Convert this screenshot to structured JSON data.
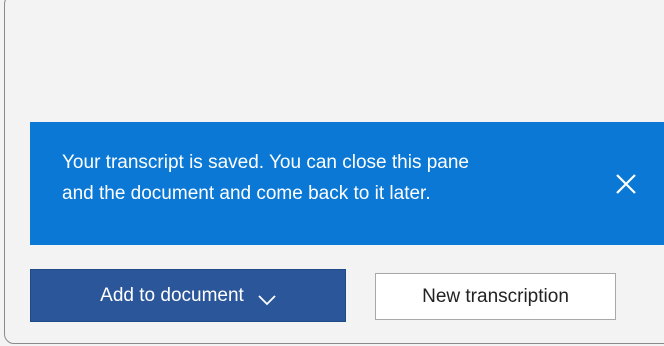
{
  "notification": {
    "message_line1": "Your transcript is saved. You can close this pane",
    "message_line2": "and the document and come back to it later.",
    "close_icon": "close-icon",
    "background_color": "#0a78d4"
  },
  "actions": {
    "add_to_document_label": "Add to document",
    "add_to_document_icon": "chevron-down-icon",
    "new_transcription_label": "New transcription",
    "primary_color": "#2b579a"
  }
}
